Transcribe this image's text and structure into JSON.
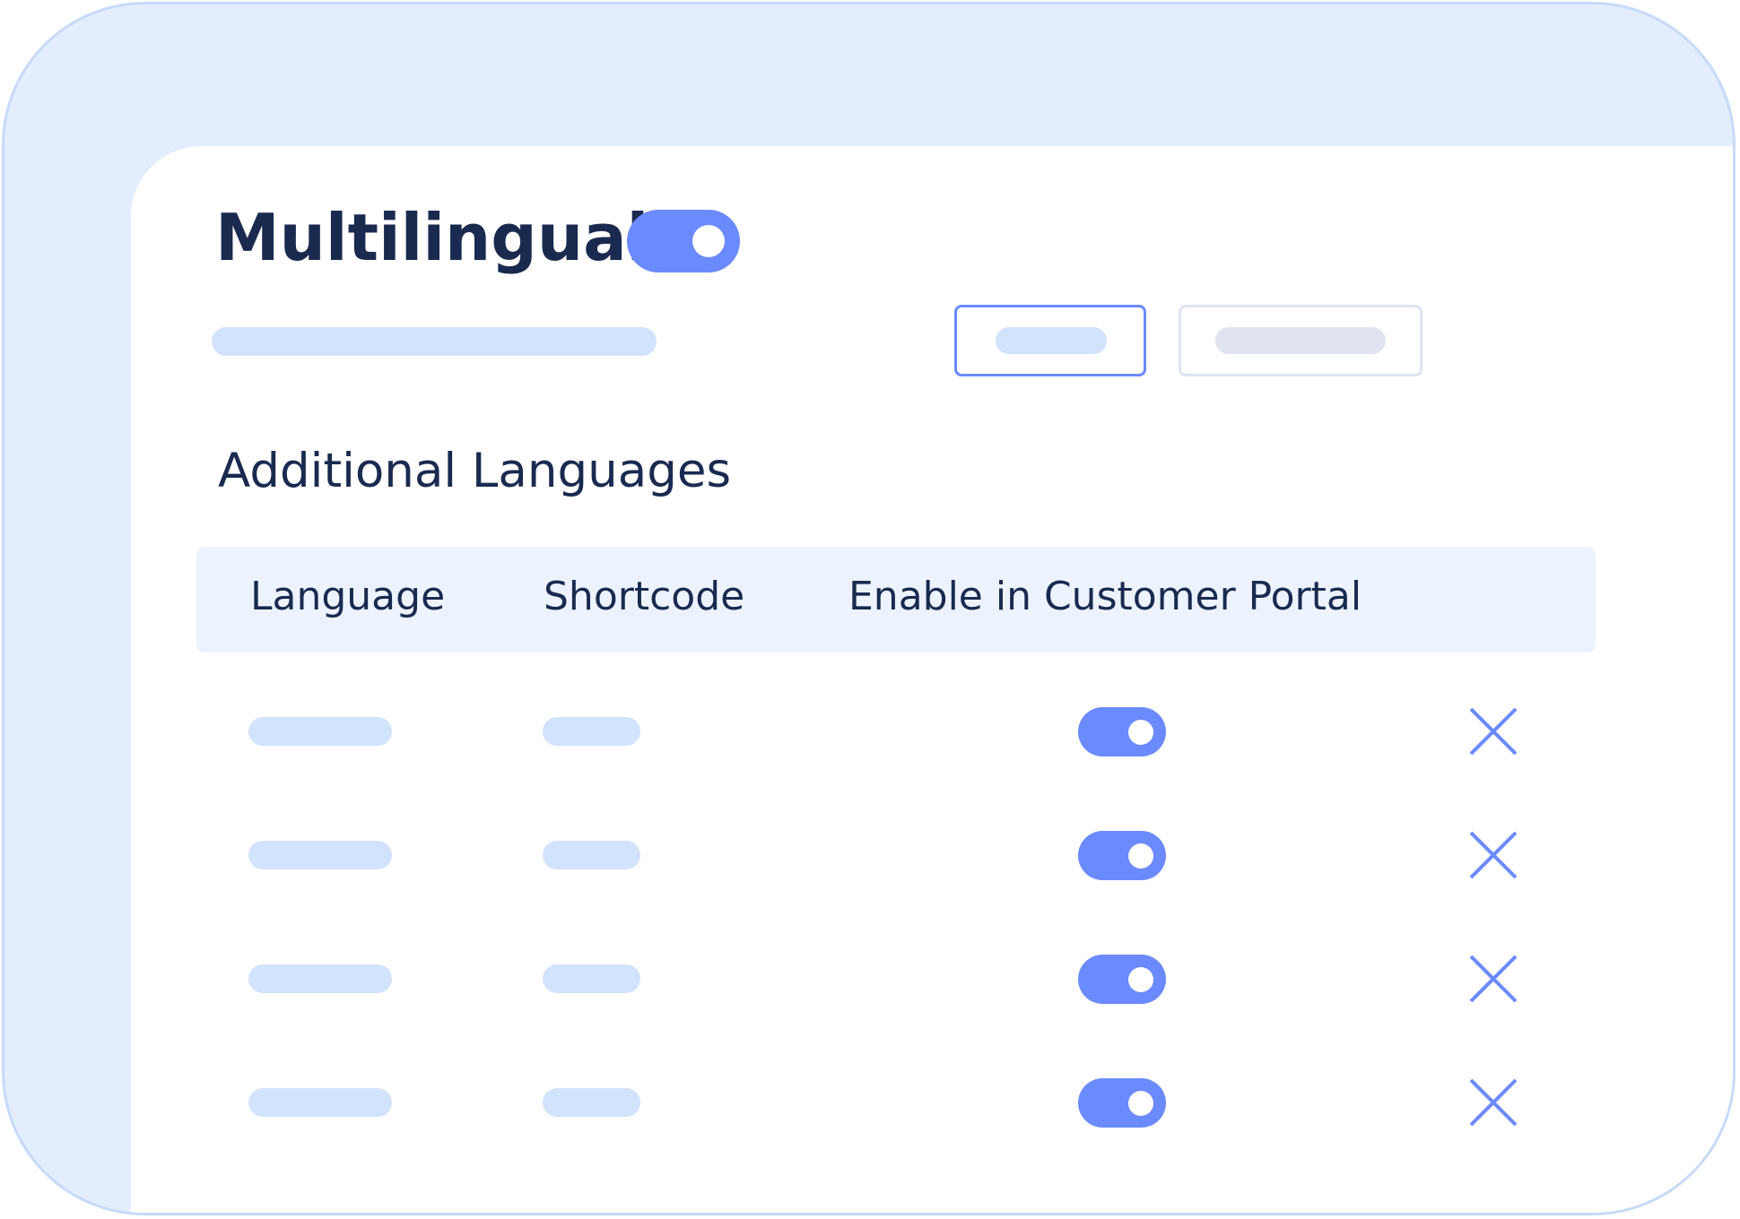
{
  "colors": {
    "accent": "#6b8afd",
    "title_text": "#1a2a4f",
    "placeholder": "#d2e3fc",
    "outer_background": "#e3edfd",
    "header_background": "#edf3fe"
  },
  "header": {
    "title": "Multilingual",
    "multilingual_enabled": true
  },
  "section": {
    "title": "Additional Languages"
  },
  "table": {
    "columns": [
      "Language",
      "Shortcode",
      "Enable in Customer Portal"
    ],
    "rows": [
      {
        "portal_enabled": true,
        "remove_icon": "close-icon"
      },
      {
        "portal_enabled": true,
        "remove_icon": "close-icon"
      },
      {
        "portal_enabled": true,
        "remove_icon": "close-icon"
      },
      {
        "portal_enabled": true,
        "remove_icon": "close-icon"
      }
    ]
  }
}
